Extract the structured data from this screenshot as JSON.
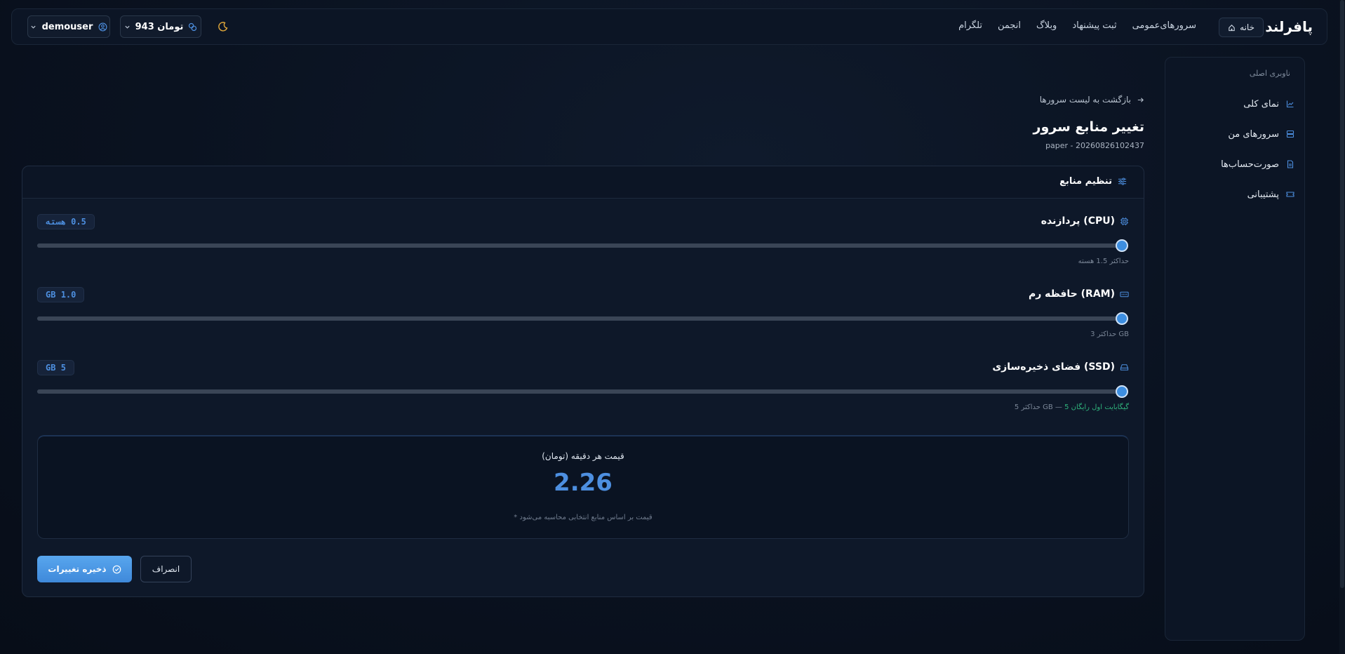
{
  "header": {
    "logo": "پافرلند",
    "home_label": "خانه",
    "nav": [
      "سرورهای‌عمومی",
      "ثبت پیشنهاد",
      "وبلاگ",
      "انجمن",
      "تلگرام"
    ],
    "credit": "943 تومان",
    "username": "demouser"
  },
  "sidebar": {
    "title": "ناوبری اصلی",
    "items": [
      {
        "label": "نمای کلی",
        "icon": "chart-line-icon"
      },
      {
        "label": "سرورهای من",
        "icon": "server-icon"
      },
      {
        "label": "صورت‌حساب‌ها",
        "icon": "document-icon"
      },
      {
        "label": "پشتیبانی",
        "icon": "ticket-icon"
      }
    ]
  },
  "main": {
    "back_label": "بازگشت به لیست سرورها",
    "title": "تغییر منابع سرور",
    "subtitle": "paper - 20260826102437",
    "card_title": "تنظیم منابع",
    "resources": [
      {
        "label": "پردازنده (CPU)",
        "value": "0.5 هسته",
        "hint": "حداکثر 1.5 هسته",
        "hint_extra": "",
        "level": 1.0,
        "icon": "cpu-icon"
      },
      {
        "label": "حافظه رم (RAM)",
        "value": "1.0 GB",
        "hint": "حداکثر 3 GB",
        "hint_extra": "",
        "level": 1.0,
        "icon": "memory-icon"
      },
      {
        "label": "فضای ذخیره‌سازی (SSD)",
        "value": "5 GB",
        "hint": "حداکثر 5 GB — ",
        "hint_extra": "5 گیگابایت اول رایگان",
        "level": 1.0,
        "icon": "storage-icon"
      }
    ],
    "price_label": "قیمت هر دقیقه (تومان)",
    "price_value": "2.26",
    "price_note": "* قیمت بر اساس منابع انتخابی محاسبه می‌شود",
    "save_label": "ذخیره تغییرات",
    "cancel_label": "انصراف"
  },
  "colors": {
    "accent": "#3d8ee0",
    "background": "#0a1220",
    "free_green": "#2fb37c"
  }
}
